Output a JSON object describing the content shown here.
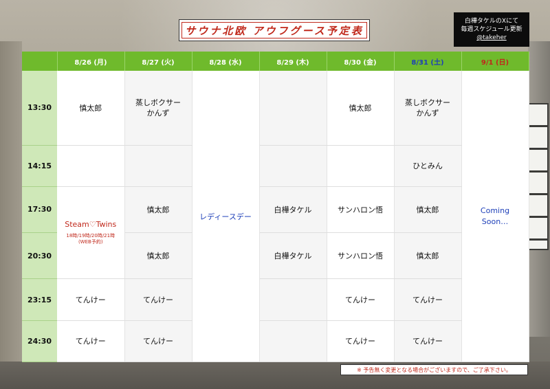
{
  "title": "サウナ北欧 アウフグース予定表",
  "info": {
    "line1": "白樺タケルのXにて",
    "line2": "毎週スケジュール更新",
    "handle": "@takeher"
  },
  "days": [
    {
      "label": "8/26 (月)",
      "tone": "normal"
    },
    {
      "label": "8/27 (火)",
      "tone": "normal"
    },
    {
      "label": "8/28 (水)",
      "tone": "normal"
    },
    {
      "label": "8/29 (木)",
      "tone": "normal"
    },
    {
      "label": "8/30 (金)",
      "tone": "normal"
    },
    {
      "label": "8/31 (土)",
      "tone": "sat"
    },
    {
      "label": "9/1 (日)",
      "tone": "sun"
    }
  ],
  "times": [
    "13:30",
    "14:15",
    "17:30",
    "20:30",
    "23:15",
    "24:30"
  ],
  "schedule": {
    "r0": [
      "慎太郎",
      "蒸しボクサー\nかんず",
      "",
      "慎太郎",
      "蒸しボクサー\nかんず"
    ],
    "r1": [
      "",
      "",
      "",
      "",
      "ひとみん"
    ],
    "r2": [
      "慎太郎",
      "白樺タケル",
      "サンハロン悟",
      "慎太郎"
    ],
    "r3": [
      "慎太郎",
      "白樺タケル",
      "サンハロン悟",
      "慎太郎"
    ],
    "r4": [
      "てんけー",
      "てんけー",
      "",
      "てんけー",
      "てんけー"
    ],
    "r5": [
      "てんけー",
      "てんけー",
      "",
      "てんけー",
      "てんけー"
    ]
  },
  "special": {
    "steam_title": "Steam♡Twins",
    "steam_sub1": "18時/19時/20時/21時",
    "steam_sub2": "(WEB予約)",
    "ladies_day": "レディースデー",
    "coming1": "Coming",
    "coming2": "Soon…"
  },
  "notice": "※ 予告無く変更となる場合がございますので、ご了承下さい。",
  "colors": {
    "header_green": "#6fba2c",
    "time_col": "#cfe8b8",
    "accent_red": "#c0281b",
    "accent_blue": "#1d3fb8"
  }
}
